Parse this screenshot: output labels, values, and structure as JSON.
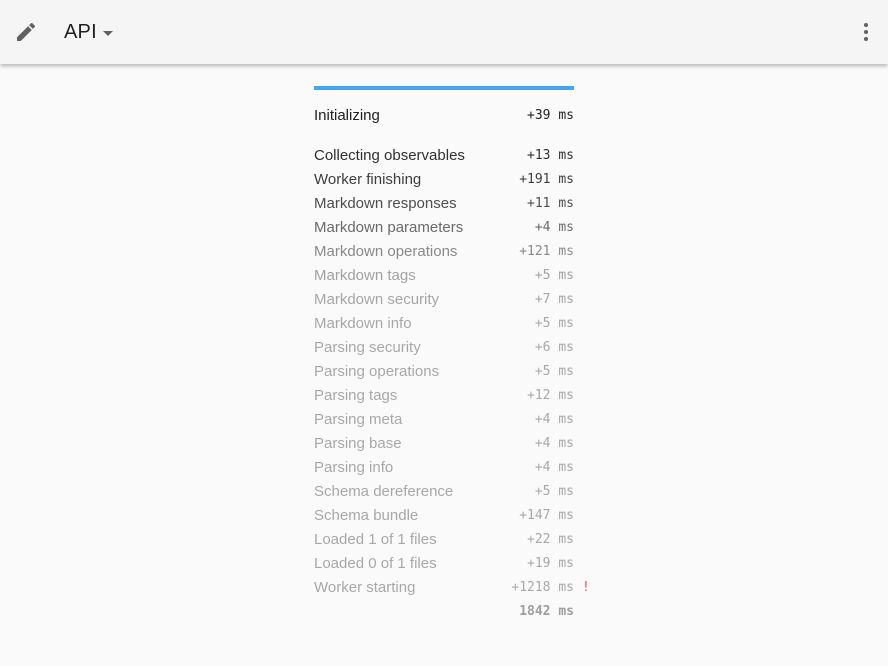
{
  "toolbar": {
    "title": "API",
    "edit_icon": "pencil-icon",
    "menu_icon": "more-vert-icon"
  },
  "progress": {
    "fraction": 1.0,
    "color": "#42a5f5"
  },
  "timings": [
    {
      "label": "Initializing",
      "time": "+39 ms",
      "color": "#212121"
    },
    {
      "label": "Collecting observables",
      "time": "+13 ms",
      "color": "#303030"
    },
    {
      "label": "Worker finishing",
      "time": "+191 ms",
      "color": "#3d3d3d"
    },
    {
      "label": "Markdown responses",
      "time": "+11 ms",
      "color": "#4e4e4e"
    },
    {
      "label": "Markdown parameters",
      "time": "+4 ms",
      "color": "#6a6a6a"
    },
    {
      "label": "Markdown operations",
      "time": "+121 ms",
      "color": "#8a8a8a"
    },
    {
      "label": "Markdown tags",
      "time": "+5 ms",
      "color": "#a2a2a2"
    },
    {
      "label": "Markdown security",
      "time": "+7 ms",
      "color": "#a6a6a6"
    },
    {
      "label": "Markdown info",
      "time": "+5 ms",
      "color": "#a8a8a8"
    },
    {
      "label": "Parsing security",
      "time": "+6 ms",
      "color": "#a8a8a8"
    },
    {
      "label": "Parsing operations",
      "time": "+5 ms",
      "color": "#a8a8a8"
    },
    {
      "label": "Parsing tags",
      "time": "+12 ms",
      "color": "#a8a8a8"
    },
    {
      "label": "Parsing meta",
      "time": "+4 ms",
      "color": "#a8a8a8"
    },
    {
      "label": "Parsing base",
      "time": "+4 ms",
      "color": "#a8a8a8"
    },
    {
      "label": "Parsing info",
      "time": "+4 ms",
      "color": "#a8a8a8"
    },
    {
      "label": "Schema dereference",
      "time": "+5 ms",
      "color": "#a8a8a8"
    },
    {
      "label": "Schema bundle",
      "time": "+147 ms",
      "color": "#a8a8a8"
    },
    {
      "label": "Loaded 1 of 1 files",
      "time": "+22 ms",
      "color": "#a8a8a8"
    },
    {
      "label": "Loaded 0 of 1 files",
      "time": "+19 ms",
      "color": "#a8a8a8"
    },
    {
      "label": "Worker starting",
      "time": "+1218 ms",
      "color": "#a8a8a8",
      "warning": "!"
    }
  ],
  "total": "1842 ms"
}
